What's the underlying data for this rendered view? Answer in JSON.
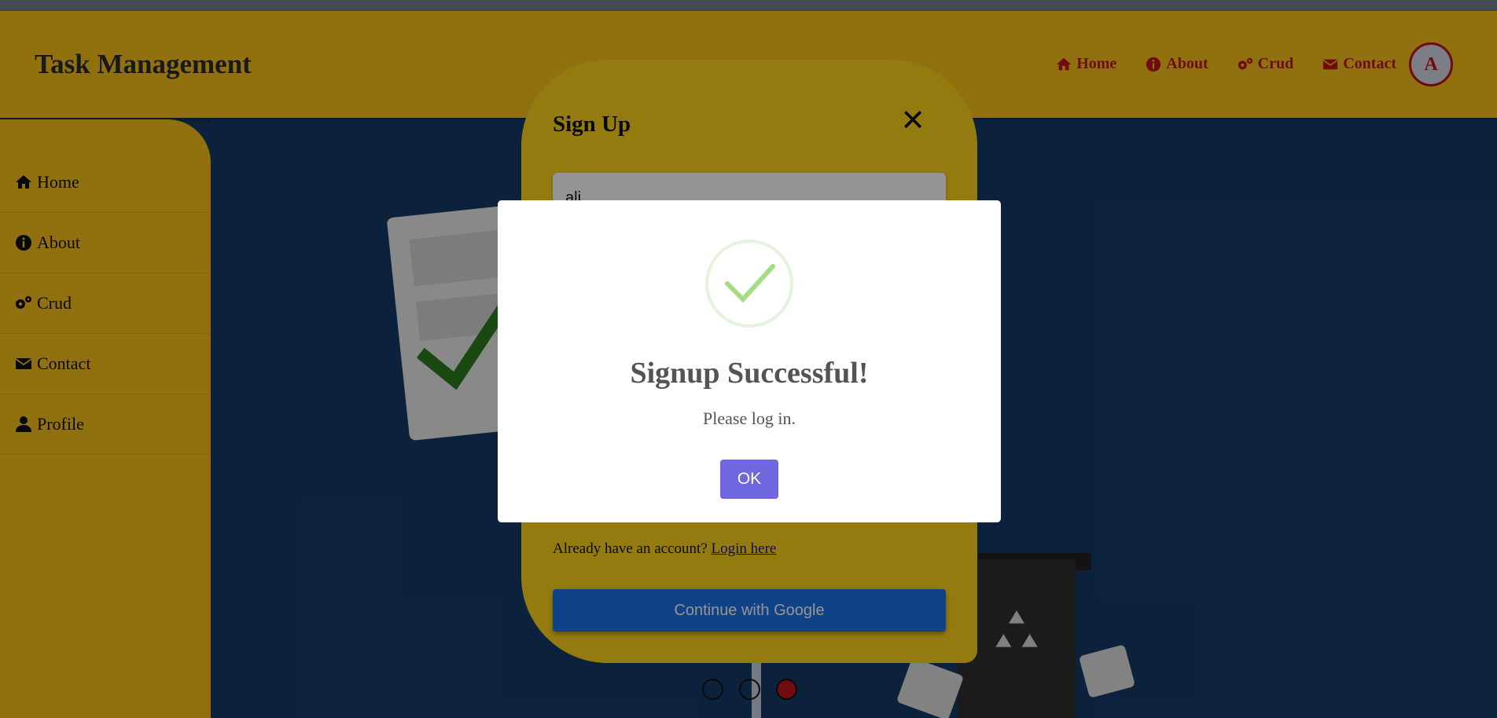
{
  "header": {
    "brand": "Task Management",
    "nav": [
      {
        "label": "Home",
        "icon": "home-icon"
      },
      {
        "label": "About",
        "icon": "info-icon"
      },
      {
        "label": "Crud",
        "icon": "gears-icon"
      },
      {
        "label": "Contact",
        "icon": "envelope-icon"
      }
    ],
    "avatar_letter": "A"
  },
  "sidebar": {
    "items": [
      {
        "label": "Home",
        "icon": "home-icon"
      },
      {
        "label": "About",
        "icon": "info-icon"
      },
      {
        "label": "Crud",
        "icon": "gears-icon"
      },
      {
        "label": "Contact",
        "icon": "envelope-icon"
      },
      {
        "label": "Profile",
        "icon": "user-icon"
      }
    ]
  },
  "carousel": {
    "slide_count": 3,
    "active_index": 2
  },
  "signup": {
    "title": "Sign Up",
    "close_symbol": "✕",
    "name_value": "ali",
    "already_text": "Already have an account?",
    "login_link": "Login here",
    "google_button": "Continue with Google"
  },
  "alert": {
    "title": "Signup Successful!",
    "text": "Please log in.",
    "ok_label": "OK",
    "icon": "success-check-icon"
  },
  "colors": {
    "header_bg": "#f8c11a",
    "nav_accent": "#c0151b",
    "hero_bg": "#163a66",
    "signup_bg": "#ffd41a",
    "google_btn": "#1a73e8",
    "ok_btn": "#7066e0"
  }
}
